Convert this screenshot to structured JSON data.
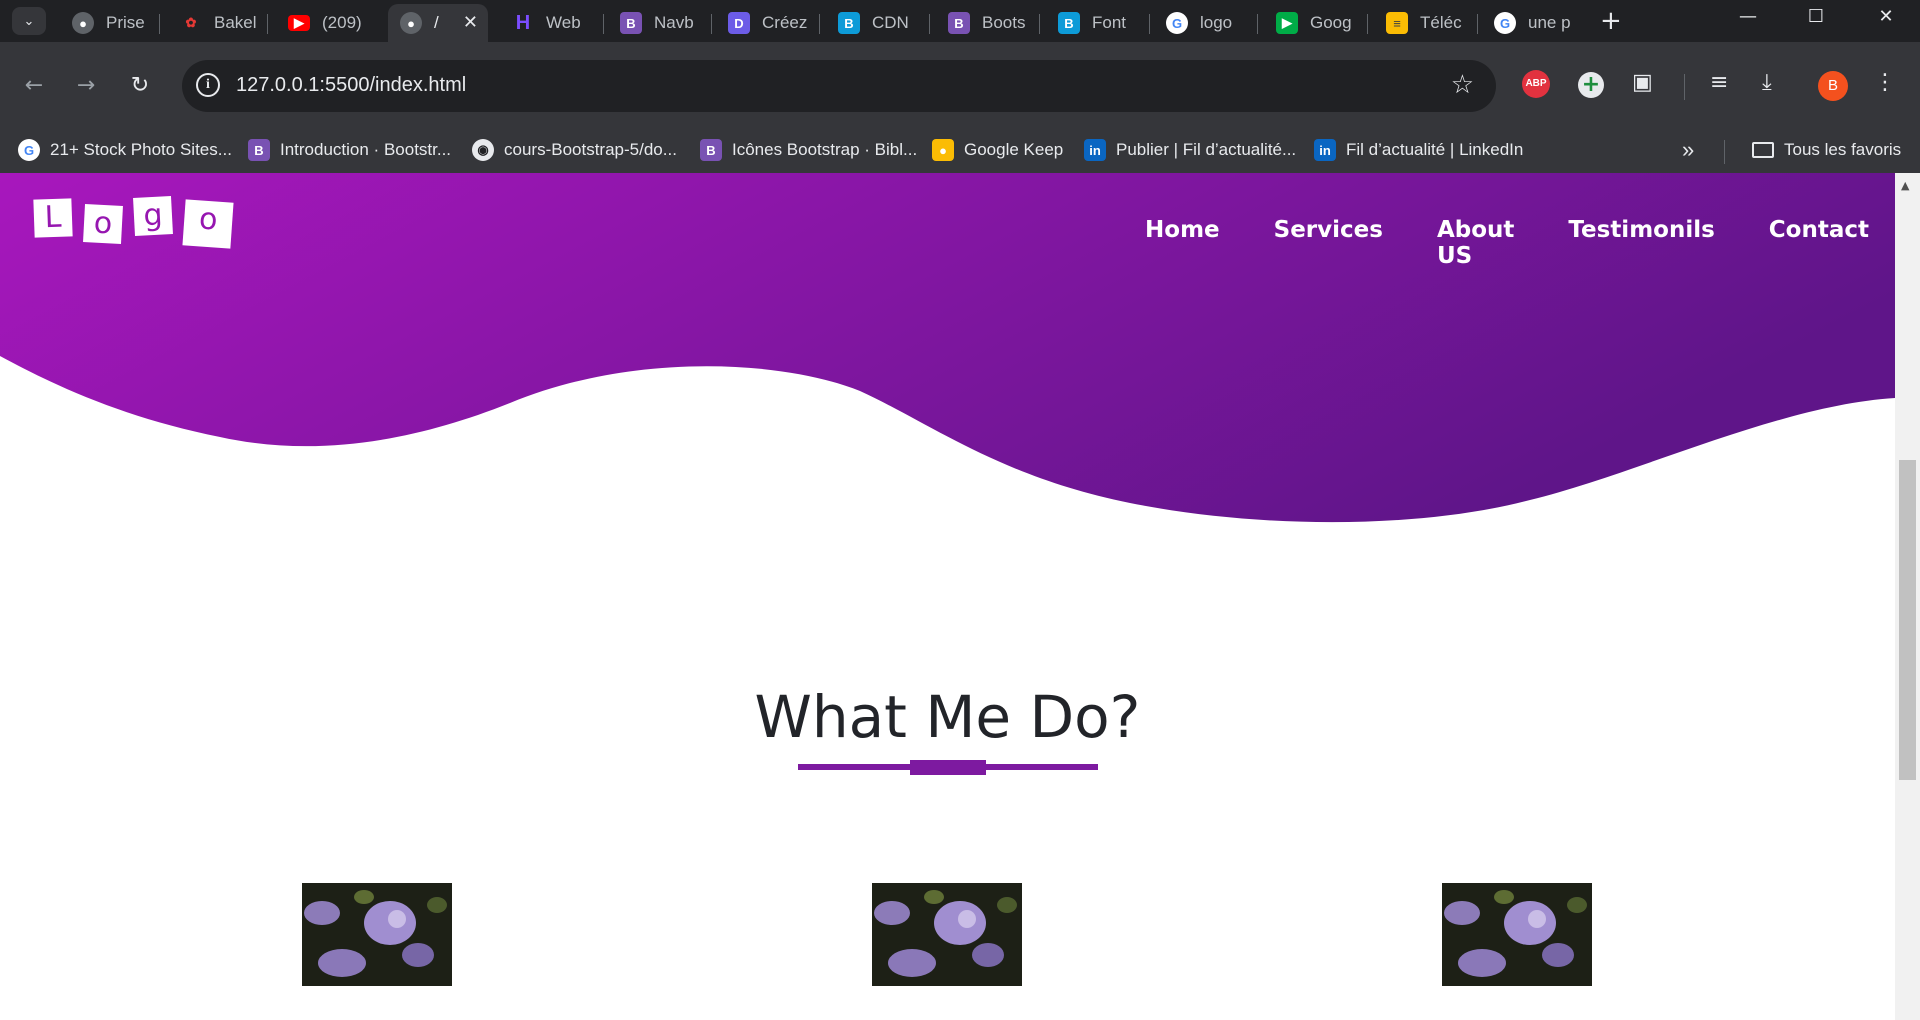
{
  "browser": {
    "tabs": [
      {
        "label": "Prise",
        "favicon": "globe-icon"
      },
      {
        "label": "Bakel",
        "favicon": "bakeli-icon"
      },
      {
        "label": "(209)",
        "favicon": "youtube-icon"
      },
      {
        "label": "/",
        "favicon": "globe-icon",
        "active": true
      },
      {
        "label": "Web",
        "favicon": "h-logo-icon"
      },
      {
        "label": "Navb",
        "favicon": "bootstrap-icon"
      },
      {
        "label": "Créez",
        "favicon": "d-logo-icon"
      },
      {
        "label": "CDN",
        "favicon": "bootstrap-cdn-icon"
      },
      {
        "label": "Boots",
        "favicon": "bootstrap-icon"
      },
      {
        "label": "Font",
        "favicon": "bootstrap-cdn-icon"
      },
      {
        "label": "logo",
        "favicon": "google-icon"
      },
      {
        "label": "Goog",
        "favicon": "google-meet-icon"
      },
      {
        "label": "Téléc",
        "favicon": "stack-icon"
      },
      {
        "label": "une p",
        "favicon": "google-icon"
      }
    ],
    "address": "127.0.0.1:5500/index.html",
    "extensions": {
      "abp": "ABP",
      "profile_initial": "B"
    },
    "bookmarks": [
      {
        "label": "21+ Stock Photo Sites...",
        "favicon": "google-icon"
      },
      {
        "label": "Introduction · Bootstr...",
        "favicon": "bootstrap-icon"
      },
      {
        "label": "cours-Bootstrap-5/do...",
        "favicon": "github-icon"
      },
      {
        "label": "Icônes Bootstrap · Bibl...",
        "favicon": "bootstrap-icon"
      },
      {
        "label": "Google Keep",
        "favicon": "keep-icon"
      },
      {
        "label": "Publier | Fil d’actualité...",
        "favicon": "linkedin-icon"
      },
      {
        "label": "Fil d’actualité | LinkedIn",
        "favicon": "linkedin-icon"
      }
    ],
    "all_bookmarks_label": "Tous les favoris"
  },
  "page": {
    "logo_letters": [
      "L",
      "o",
      "g",
      "o"
    ],
    "nav": [
      "Home",
      "Services",
      "About US",
      "Testimonils",
      "Contact"
    ],
    "section_title": "What Me Do?",
    "colors": {
      "gradient_start": "#a817bd",
      "gradient_end": "#5f1589",
      "accent": "#7d1aa0",
      "title": "#222429"
    }
  }
}
